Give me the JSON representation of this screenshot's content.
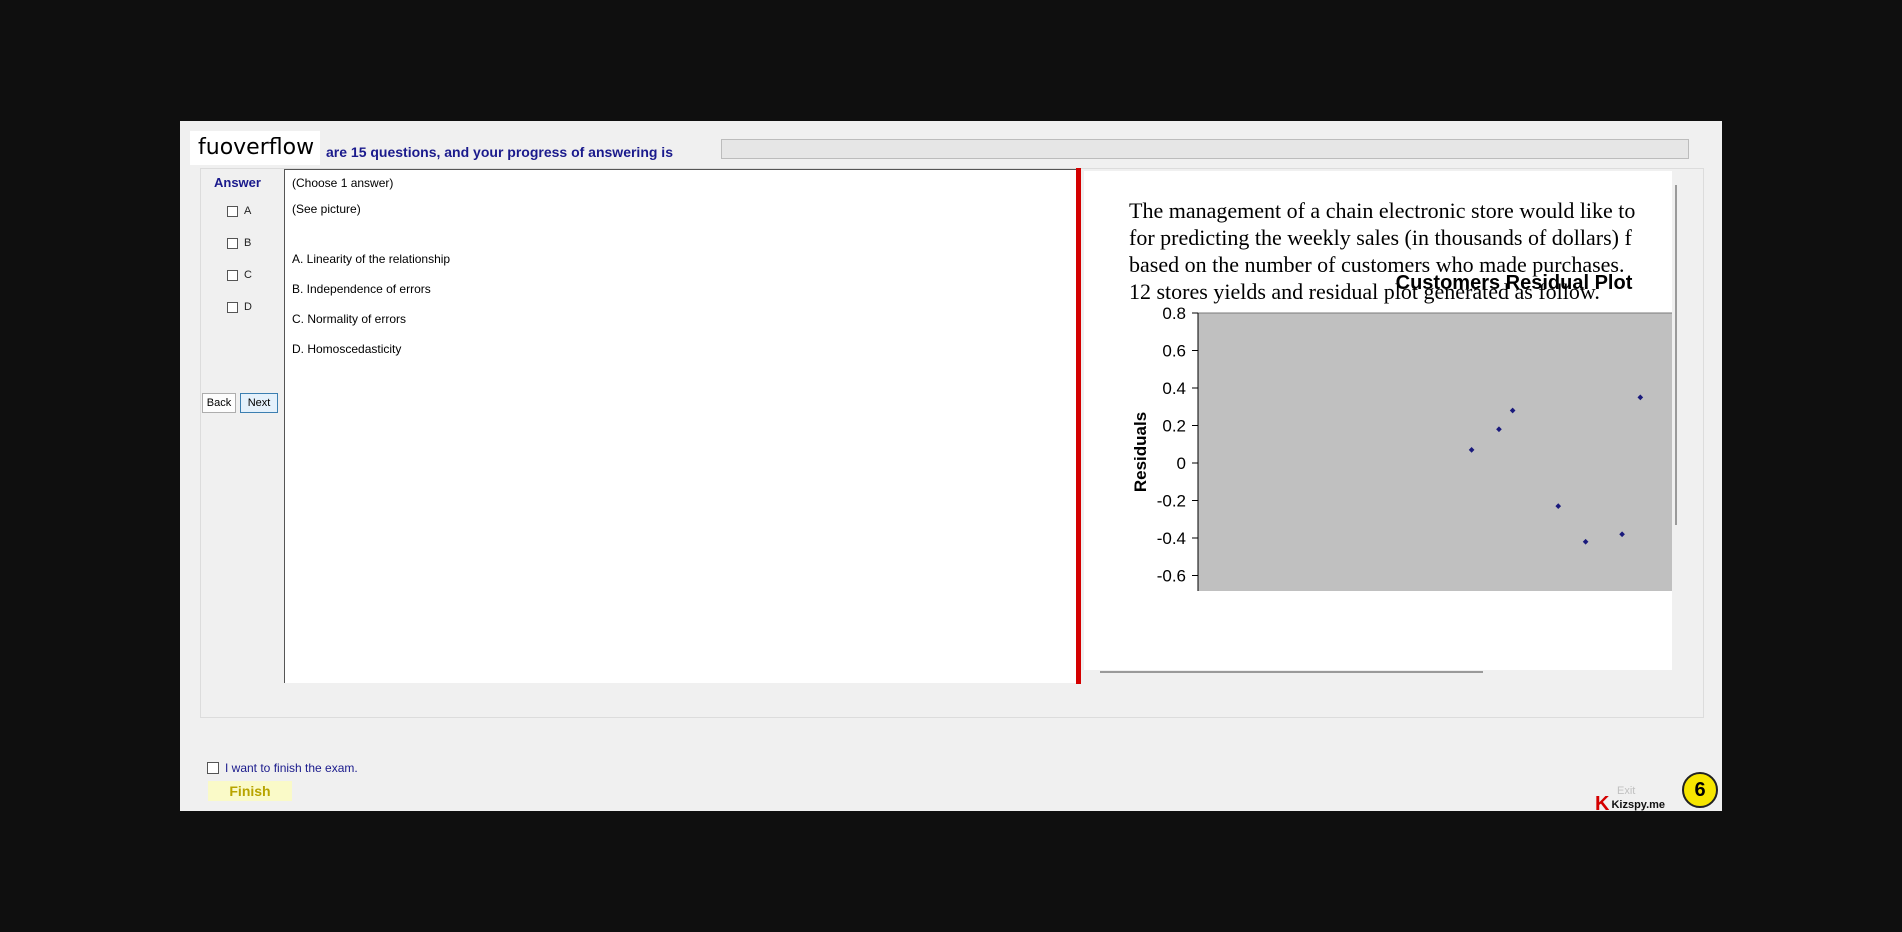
{
  "header": {
    "logo_text": "fuoverflow",
    "progress_text": "are 15 questions, and your progress of answering is",
    "progress_value": 0
  },
  "answer_panel": {
    "title": "Answer",
    "options": [
      "A",
      "B",
      "C",
      "D"
    ],
    "back_label": "Back",
    "next_label": "Next"
  },
  "question": {
    "lines": [
      "(Choose 1 answer)",
      "(See picture)",
      "A.  Linearity of the relationship",
      "B.  Independence of errors",
      "C.  Normality of errors",
      "D.  Homoscedasticity"
    ]
  },
  "picture": {
    "text_lines": [
      "The management of a chain electronic store would like to",
      "for predicting the weekly sales (in thousands of dollars) f",
      "based on the number of customers who made purchases.",
      "12 stores yields and residual plot generated as follow."
    ]
  },
  "chart_data": {
    "type": "scatter",
    "title": "Customers  Residual Plot",
    "ylabel": "Residuals",
    "xlabel": "",
    "ylim": [
      -0.7,
      0.8
    ],
    "yticks": [
      "0.8",
      "0.6",
      "0.4",
      "0.2",
      "0",
      "-0.2",
      "-0.4",
      "-0.6"
    ],
    "grid": false,
    "plot_bg": "#c0c0c0",
    "marker_color": "#1a1a7c",
    "points": [
      {
        "x": 0.6,
        "y": 0.07
      },
      {
        "x": 0.66,
        "y": 0.18
      },
      {
        "x": 0.69,
        "y": 0.28
      },
      {
        "x": 0.79,
        "y": -0.23
      },
      {
        "x": 0.85,
        "y": -0.42
      },
      {
        "x": 0.93,
        "y": -0.38
      },
      {
        "x": 0.97,
        "y": 0.35
      }
    ]
  },
  "footer": {
    "finish_checkbox_label": "I want to finish the exam.",
    "finish_label": "Finish",
    "exit_label": "Exit",
    "brand_mark": "K",
    "brand_name": "Kizspy.me",
    "badge_number": "6"
  },
  "colors": {
    "accent": "#1a1a8c",
    "divider": "#d40000",
    "badge": "#f7e600"
  }
}
